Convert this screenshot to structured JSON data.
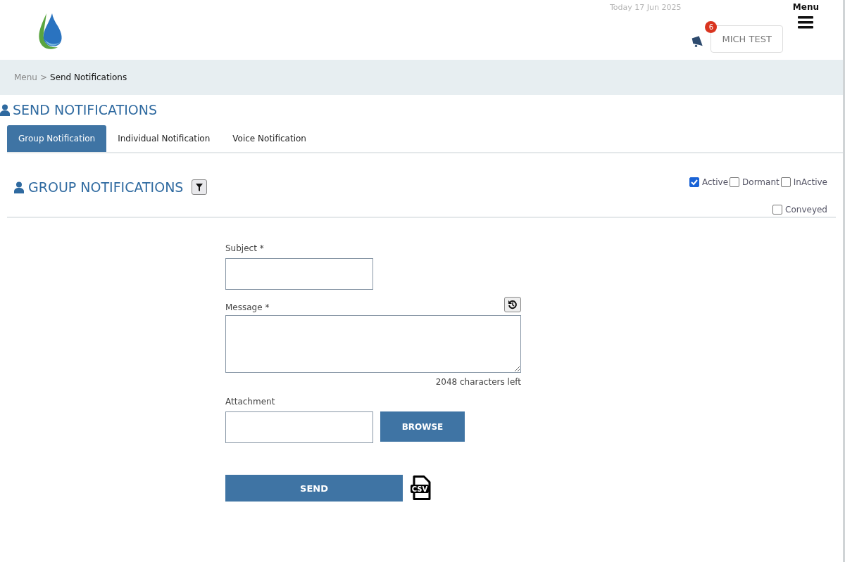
{
  "header": {
    "date": "Today 17 Jun 2025",
    "menu_label": "Menu",
    "notification_count": "6",
    "user_button": "MICH TEST"
  },
  "breadcrumb": {
    "parent": "Menu",
    "separator": ">",
    "current": "Send Notifications"
  },
  "page_title": "SEND NOTIFICATIONS",
  "tabs": [
    {
      "label": "Group Notification",
      "selected": true
    },
    {
      "label": "Individual Notification",
      "selected": false
    },
    {
      "label": "Voice Notification",
      "selected": false
    }
  ],
  "section_title": "GROUP NOTIFICATIONS",
  "status_filters": [
    {
      "label": "Active",
      "checked": true
    },
    {
      "label": "Dormant",
      "checked": false
    },
    {
      "label": "InActive",
      "checked": false
    },
    {
      "label": "Conveyed",
      "checked": false
    }
  ],
  "form": {
    "subject_label": "Subject *",
    "message_label": "Message *",
    "characters_left": "2048 characters left",
    "attachment_label": "Attachment",
    "browse_button": "BROWSE",
    "send_button": "SEND",
    "csv_icon_label": "CSV"
  }
}
